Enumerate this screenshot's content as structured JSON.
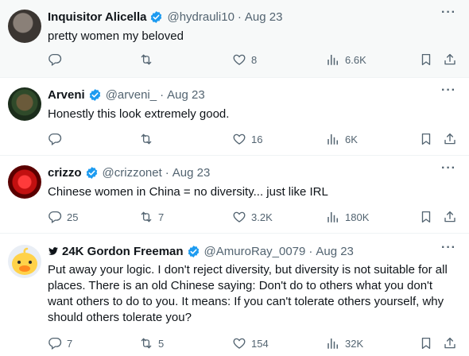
{
  "tweets": [
    {
      "name": "Inquisitor Alicella",
      "handle": "@hydrauli10",
      "time": "Aug 23",
      "text": "pretty women my beloved",
      "replies": "",
      "retweets": "",
      "likes": "8",
      "views": "6.6K"
    },
    {
      "name": "Arveni",
      "handle": "@arveni_",
      "time": "Aug 23",
      "text": "Honestly this look extremely good.",
      "replies": "",
      "retweets": "",
      "likes": "16",
      "views": "6K"
    },
    {
      "name": "crizzo",
      "handle": "@crizzonet",
      "time": "Aug 23",
      "text": "Chinese women in China = no diversity... just like IRL",
      "replies": "25",
      "retweets": "7",
      "likes": "3.2K",
      "views": "180K"
    },
    {
      "name": "24K Gordon Freeman",
      "handle": "@AmuroRay_0079",
      "time": "Aug 23",
      "text": "Put away your logic. I don't reject diversity, but diversity is not suitable for all places. There is an old Chinese saying: Don't do to others what you don't want others to do to you. It means: If you can't tolerate others yourself, why should others tolerate you?",
      "replies": "7",
      "retweets": "5",
      "likes": "154",
      "views": "32K"
    }
  ],
  "ui": {
    "separator": "·",
    "more": "···"
  },
  "colors": {
    "verified": "#1d9bf0",
    "secondary_text": "#536471",
    "primary_text": "#0f1419"
  },
  "icons": [
    "reply-icon",
    "retweet-icon",
    "like-icon",
    "views-icon",
    "bookmark-icon",
    "share-icon",
    "verified-icon",
    "twitter-bird-icon",
    "more-icon"
  ]
}
